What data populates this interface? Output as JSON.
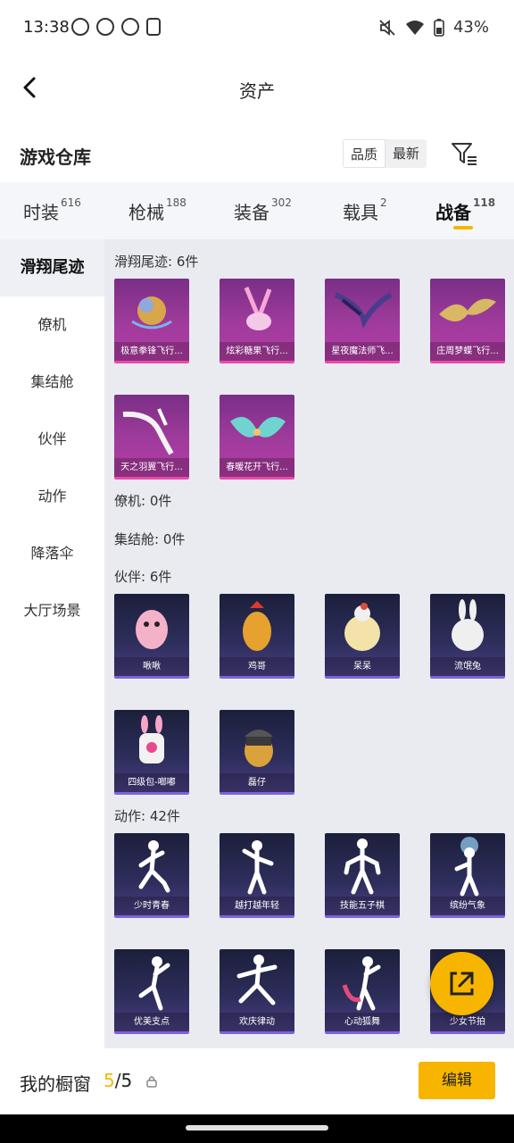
{
  "status": {
    "time": "13:38",
    "battery": "43%"
  },
  "header": {
    "title": "资产"
  },
  "subheader": {
    "title": "游戏仓库",
    "sort_quality": "品质",
    "sort_latest": "最新"
  },
  "tabs": [
    {
      "label": "时装",
      "count": "616"
    },
    {
      "label": "枪械",
      "count": "188"
    },
    {
      "label": "装备",
      "count": "302"
    },
    {
      "label": "载具",
      "count": "2"
    },
    {
      "label": "战备",
      "count": "118"
    }
  ],
  "sidebar": {
    "items": [
      "滑翔尾迹",
      "僚机",
      "集结舱",
      "伙伴",
      "动作",
      "降落伞",
      "大厅场景"
    ]
  },
  "sections": {
    "glide": {
      "title": "滑翔尾迹: 6件",
      "items": [
        "极意拳锋飞行...",
        "炫彩糖果飞行...",
        "星夜魔法师飞...",
        "庄周梦蝶飞行...",
        "天之羽翼飞行...",
        "春暖花开飞行..."
      ]
    },
    "wingman": {
      "title": "僚机: 0件"
    },
    "capsule": {
      "title": "集结舱: 0件"
    },
    "partner": {
      "title": "伙伴: 6件",
      "items": [
        "啾啾",
        "鸡哥",
        "呆呆",
        "流氓兔",
        "四级包-啷嘟",
        "磊仔"
      ]
    },
    "emote": {
      "title": "动作: 42件",
      "items": [
        "少时青春",
        "越打越年轻",
        "技能五子棋",
        "缤纷气象",
        "优美支点",
        "欢庆律动",
        "心动狐舞",
        "少女节拍"
      ]
    }
  },
  "bottom": {
    "showcase_label": "我的橱窗",
    "showcase_current": "5",
    "showcase_total": "/5",
    "edit_label": "编辑"
  },
  "colors": {
    "accent": "#f7b500",
    "pink_card": "#a03b9c",
    "purple_card": "#2e2e5c"
  }
}
